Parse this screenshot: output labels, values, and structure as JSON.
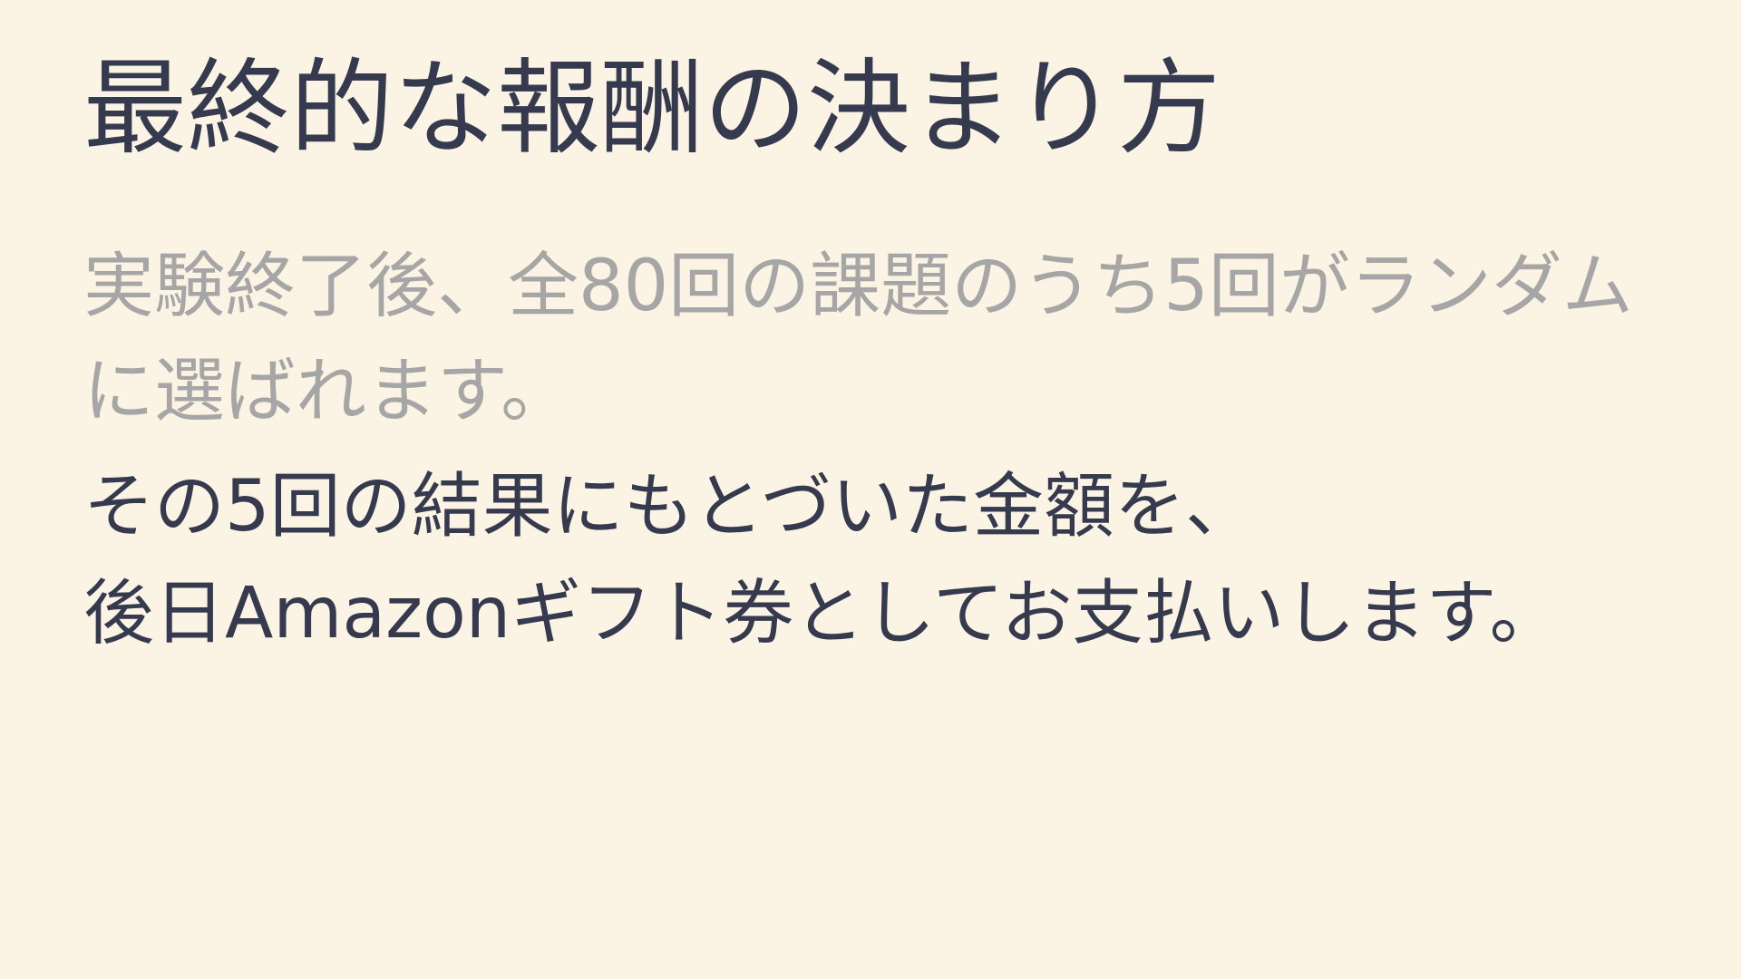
{
  "slide": {
    "title": "最終的な報酬の決まり方",
    "note": {
      "line1": "実験終了後、全80回の課題のうち5回がランダム",
      "line2": "に選ばれます。"
    },
    "main": {
      "line1": "その5回の結果にもとづいた金額を、",
      "line2": "後日Amazonギフト券としてお支払いします。"
    }
  }
}
